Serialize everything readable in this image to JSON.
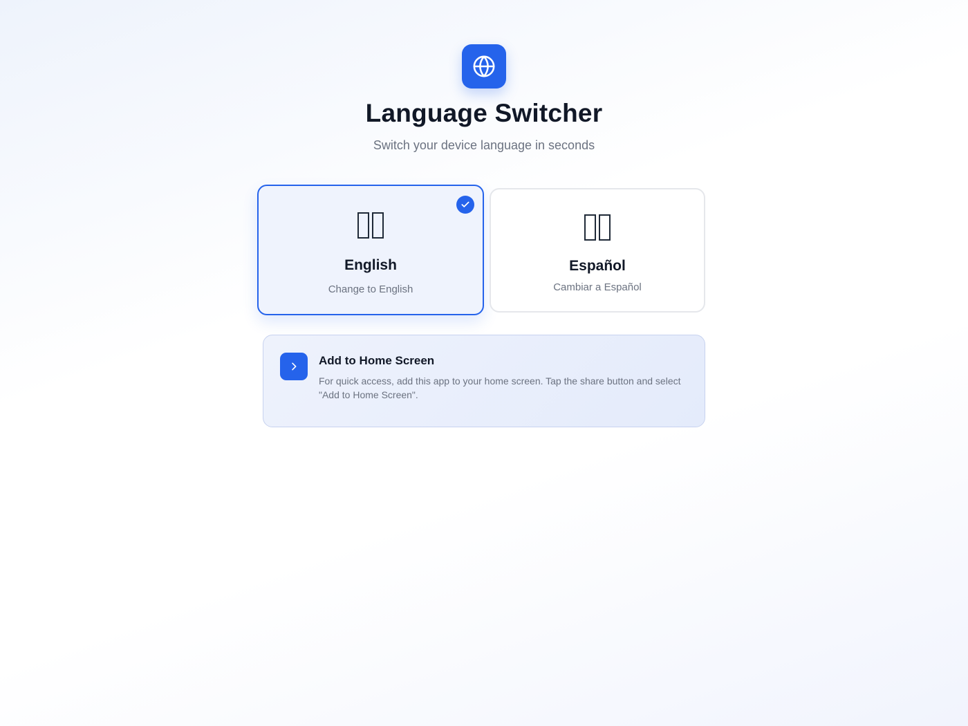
{
  "header": {
    "icon": "globe-icon",
    "title": "Language Switcher",
    "subtitle": "Switch your device language in seconds"
  },
  "languages": [
    {
      "name": "English",
      "action": "Change to English",
      "flag_icon": "flag-placeholder-icon",
      "selected": true
    },
    {
      "name": "Español",
      "action": "Cambiar a Español",
      "flag_icon": "flag-placeholder-icon",
      "selected": false
    }
  ],
  "tip": {
    "icon": "chevron-right-icon",
    "title": "Add to Home Screen",
    "body": "For quick access, add this app to your home screen. Tap the share button and select \"Add to Home Screen\"."
  },
  "colors": {
    "accent": "#2563eb",
    "text_primary": "#111827",
    "text_secondary": "#6b7280"
  }
}
